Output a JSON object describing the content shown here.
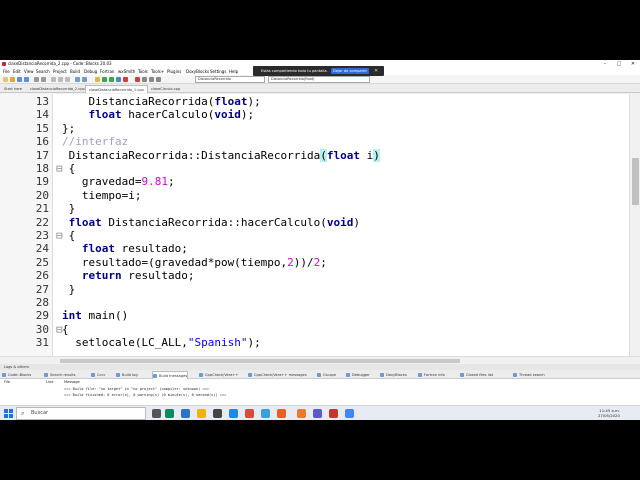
{
  "window": {
    "title": "claseDistanciaRecorrida_2.cpp - Code::Blocks 20.03",
    "minimize": "–",
    "maximize": "□",
    "close": "✕"
  },
  "menu": [
    "File",
    "Edit",
    "View",
    "Search",
    "Project",
    "Build",
    "Debug",
    "Fortran",
    "wxSmith",
    "Tools",
    "Tools+",
    "Plugins",
    "DoxyBlocks",
    "Settings",
    "Help"
  ],
  "toolbar": {
    "scope_combo": "DistanciaRecorrida",
    "function_combo": "DistanciaRecorrida(float)"
  },
  "share_notice": {
    "message": "Estás compartiendo toda tu pantalla.",
    "stop_label": "Dejar de compartir",
    "hide_label": "✕"
  },
  "editor_tabs": [
    "Start here",
    "claseDistanciaRecorrida_2.cpp",
    "claseDistanciaRecorrida_1.cpp",
    "claseCirculo.cpp"
  ],
  "code": {
    "lines": [
      {
        "n": "13",
        "fold": "",
        "parts": [
          {
            "t": "    DistanciaRecorrida(",
            "c": ""
          },
          {
            "t": "float",
            "c": "kw"
          },
          {
            "t": ");",
            "c": ""
          }
        ]
      },
      {
        "n": "14",
        "fold": "",
        "parts": [
          {
            "t": "    ",
            "c": ""
          },
          {
            "t": "float",
            "c": "kw"
          },
          {
            "t": " hacerCalculo(",
            "c": ""
          },
          {
            "t": "void",
            "c": "kw"
          },
          {
            "t": ");",
            "c": ""
          }
        ]
      },
      {
        "n": "15",
        "fold": "",
        "parts": [
          {
            "t": "};",
            "c": ""
          }
        ]
      },
      {
        "n": "16",
        "fold": "",
        "parts": [
          {
            "t": "//",
            "c": "cmt"
          },
          {
            "t": "interfaz",
            "c": "cmt"
          }
        ]
      },
      {
        "n": "17",
        "fold": "",
        "parts": [
          {
            "t": " DistanciaRecorrida::DistanciaRecorrida",
            "c": ""
          },
          {
            "t": "(",
            "c": "hl"
          },
          {
            "t": "float",
            "c": "kw"
          },
          {
            "t": " i",
            "c": ""
          },
          {
            "t": ")",
            "c": "hl"
          }
        ]
      },
      {
        "n": "18",
        "fold": "⊟",
        "parts": [
          {
            "t": " {",
            "c": ""
          }
        ]
      },
      {
        "n": "19",
        "fold": "",
        "parts": [
          {
            "t": "   gravedad=",
            "c": ""
          },
          {
            "t": "9.81",
            "c": "num"
          },
          {
            "t": ";",
            "c": ""
          }
        ]
      },
      {
        "n": "20",
        "fold": "",
        "parts": [
          {
            "t": "   tiempo=i;",
            "c": ""
          }
        ]
      },
      {
        "n": "21",
        "fold": "",
        "parts": [
          {
            "t": " }",
            "c": ""
          }
        ]
      },
      {
        "n": "22",
        "fold": "",
        "parts": [
          {
            "t": " ",
            "c": ""
          },
          {
            "t": "float",
            "c": "kw"
          },
          {
            "t": " DistanciaRecorrida::hacerCalculo(",
            "c": ""
          },
          {
            "t": "void",
            "c": "kw"
          },
          {
            "t": ")",
            "c": ""
          }
        ]
      },
      {
        "n": "23",
        "fold": "⊟",
        "parts": [
          {
            "t": " {",
            "c": ""
          }
        ]
      },
      {
        "n": "24",
        "fold": "",
        "parts": [
          {
            "t": "   ",
            "c": ""
          },
          {
            "t": "float",
            "c": "kw"
          },
          {
            "t": " resultado;",
            "c": ""
          }
        ]
      },
      {
        "n": "25",
        "fold": "",
        "parts": [
          {
            "t": "   resultado=(gravedad*pow(tiempo,",
            "c": ""
          },
          {
            "t": "2",
            "c": "num"
          },
          {
            "t": "))/",
            "c": ""
          },
          {
            "t": "2",
            "c": "num"
          },
          {
            "t": ";",
            "c": ""
          }
        ]
      },
      {
        "n": "26",
        "fold": "",
        "parts": [
          {
            "t": "   ",
            "c": ""
          },
          {
            "t": "return",
            "c": "kw"
          },
          {
            "t": " resultado;",
            "c": ""
          }
        ]
      },
      {
        "n": "27",
        "fold": "",
        "parts": [
          {
            "t": " }",
            "c": ""
          }
        ]
      },
      {
        "n": "28",
        "fold": "",
        "parts": []
      },
      {
        "n": "29",
        "fold": "",
        "parts": [
          {
            "t": "int",
            "c": "kw"
          },
          {
            "t": " main()",
            "c": ""
          }
        ]
      },
      {
        "n": "30",
        "fold": "⊟",
        "parts": [
          {
            "t": "{",
            "c": ""
          }
        ]
      },
      {
        "n": "31",
        "fold": "",
        "parts": [
          {
            "t": "  setlocale(LC_ALL,",
            "c": ""
          },
          {
            "t": "\"Spanish\"",
            "c": "str"
          },
          {
            "t": ");",
            "c": ""
          }
        ]
      }
    ]
  },
  "logs": {
    "title": "Logs & others",
    "tabs": [
      "Code::Blocks",
      "Search results",
      "Cccc",
      "Build log",
      "Build messages",
      "CppCheck/Vera++",
      "CppCheck/Vera++ messages",
      "Cscope",
      "Debugger",
      "DoxyBlocks",
      "Fortran info",
      "Closed files list",
      "Thread search"
    ],
    "active_tab": 4,
    "columns": [
      "File",
      "Line",
      "Message"
    ],
    "messages": [
      "=== Build file: \"no target\" in \"no project\" (compiler: unknown) ===",
      "=== Build finished: 0 error(s), 0 warning(s) (0 minute(s), 0 second(s)) ==="
    ]
  },
  "taskbar": {
    "search_placeholder": "Buscar",
    "search_icon": "magnifier-icon",
    "time": "11:45 a.m.",
    "date": "27/05/2020"
  },
  "colors": {
    "keyword": "#00008b",
    "number": "#e000e0",
    "string": "#0000ff",
    "comment": "#a0a0c8",
    "brace_highlight": "#b8f0f0",
    "share_button": "#2d6ad6"
  }
}
